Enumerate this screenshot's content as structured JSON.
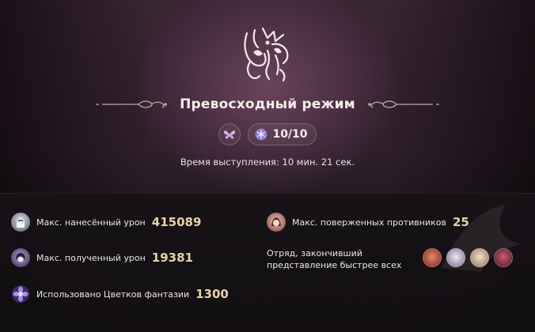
{
  "mode": {
    "title": "Превосходный режим",
    "emblem_icon": "theater-mask-emblem-icon"
  },
  "badges": {
    "butterfly_icon": "butterfly-icon",
    "star_icon": "snowflake-star-icon",
    "progress_text": "10/10",
    "progress_value": 1.0
  },
  "performance_time": "Время выступления: 10 мин. 21 сек.",
  "stats": {
    "max_damage_dealt": {
      "label": "Макс. нанесённый урон",
      "value": "415089",
      "avatar_icon": "character-avatar-icon"
    },
    "max_enemies_defeated": {
      "label": "Макс. поверженных противников",
      "value": "25",
      "avatar_icon": "character-avatar-icon"
    },
    "max_damage_taken": {
      "label": "Макс. полученный урон",
      "value": "19381",
      "avatar_icon": "character-avatar-icon"
    },
    "fastest_team": {
      "label": "Отряд, закончивший представление быстрее всех",
      "member_count": 4
    },
    "fantasia_flowers_used": {
      "label": "Использовано Цветков фантазии",
      "value": "1300",
      "icon": "fantasia-flower-icon"
    }
  },
  "colors": {
    "accent_gold": "#e8d3a6",
    "badge_purple": "#b9a0e8"
  }
}
